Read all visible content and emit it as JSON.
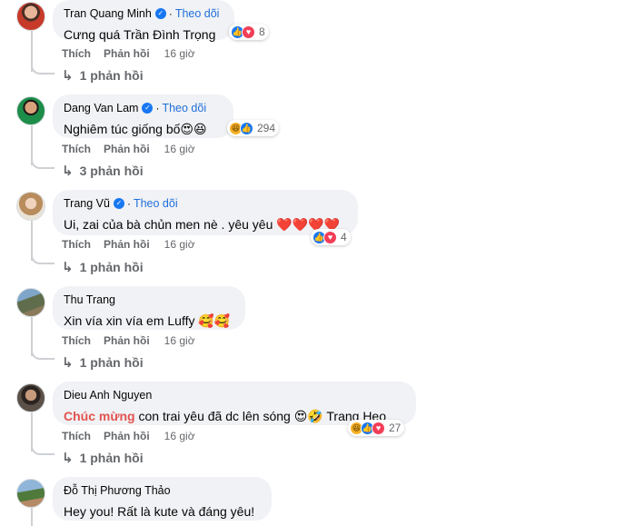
{
  "ui": {
    "follow_label": "Theo dõi",
    "like_label": "Thích",
    "reply_label": "Phản hồi"
  },
  "comments": [
    {
      "author": "Tran Quang Minh",
      "verified": true,
      "text": "Cưng quá",
      "tag": "Trần Đình Trọng",
      "reactions": [
        "like",
        "love"
      ],
      "reaction_count": "8",
      "time": "16 giờ",
      "replies": "1 phản hồi"
    },
    {
      "author": "Dang Van Lam",
      "verified": true,
      "text": "Nghiêm túc giống bố😍😆",
      "reactions": [
        "haha",
        "like"
      ],
      "reaction_count": "294",
      "time": "16 giờ",
      "replies": "3 phản hồi"
    },
    {
      "author": "Trang Vũ",
      "verified": true,
      "text": "Ui, zai của bà chủn men nè . yêu yêu ❤️❤️❤️❤️",
      "reactions": [
        "like",
        "love"
      ],
      "reaction_count": "4",
      "time": "16 giờ",
      "replies": "1 phản hồi"
    },
    {
      "author": "Thu Trang",
      "verified": false,
      "text": "Xin vía xin vía em Luffy 🥰🥰",
      "time": "16 giờ",
      "replies": "1 phản hồi"
    },
    {
      "author": "Dieu Anh Nguyen",
      "verified": false,
      "highlight": "Chúc mừng",
      "text": "con trai yêu đã dc lên sóng 😍🤣",
      "tag": "Trang Heo",
      "reactions": [
        "haha",
        "like",
        "love"
      ],
      "reaction_count": "27",
      "time": "16 giờ",
      "replies": "1 phản hồi"
    },
    {
      "author": "Đỗ Thị Phương Thảo",
      "verified": false,
      "text": "Hey you! Rất là kute và đáng yêu!"
    }
  ],
  "colors": {
    "bubble": "#f0f2f5",
    "link": "#216fdb",
    "like": "#1877f2",
    "love": "#f33e58",
    "muted": "#65676b"
  }
}
